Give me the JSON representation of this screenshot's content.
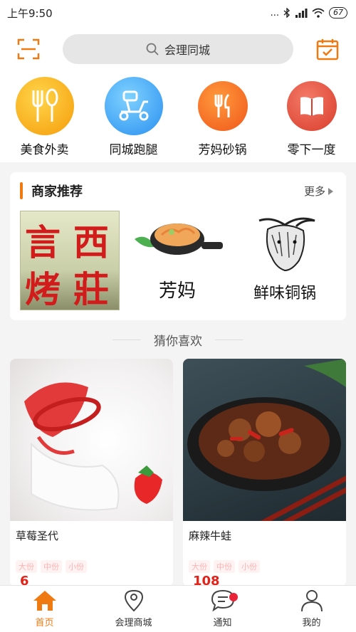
{
  "status_bar": {
    "time": "上午9:50",
    "signal_dots": "...",
    "battery": "67"
  },
  "header": {
    "search_placeholder": "会理同城",
    "scan_icon": "scan-icon",
    "calendar_icon": "calendar-check-icon"
  },
  "categories": [
    {
      "label": "美食外卖",
      "icon": "fork-spoon-icon",
      "color": "#f6a70f"
    },
    {
      "label": "同城跑腿",
      "icon": "scooter-icon",
      "color": "#2f9bf0"
    },
    {
      "label": "芳妈砂锅",
      "icon": "knife-fork-icon",
      "color": "#f46a1a"
    },
    {
      "label": "零下一度",
      "icon": "book-icon",
      "color": "#e84b3a"
    }
  ],
  "merchants": {
    "title": "商家推荐",
    "more": "更多",
    "items": [
      {
        "name": "言西烤莊",
        "chars": [
          "言",
          "西",
          "烤",
          "莊"
        ]
      },
      {
        "name": "芳妈"
      },
      {
        "name": "鲜味铜锅"
      }
    ]
  },
  "guess_title": "猜你喜欢",
  "products": [
    {
      "name": "草莓圣代",
      "tags": [
        "大份",
        "中份",
        "小份"
      ],
      "price": "6"
    },
    {
      "name": "麻辣牛蛙",
      "tags": [
        "大份",
        "中份",
        "小份"
      ],
      "price": "108"
    }
  ],
  "bottom_nav": [
    {
      "label": "首页",
      "icon": "home-icon",
      "active": true
    },
    {
      "label": "会理商城",
      "icon": "location-pin-icon",
      "active": false
    },
    {
      "label": "通知",
      "icon": "chat-bubble-icon",
      "active": false
    },
    {
      "label": "我的",
      "icon": "person-icon",
      "active": false
    }
  ],
  "colors": {
    "accent": "#f07a12",
    "badge": "#e8233a",
    "price": "#e2231a"
  }
}
